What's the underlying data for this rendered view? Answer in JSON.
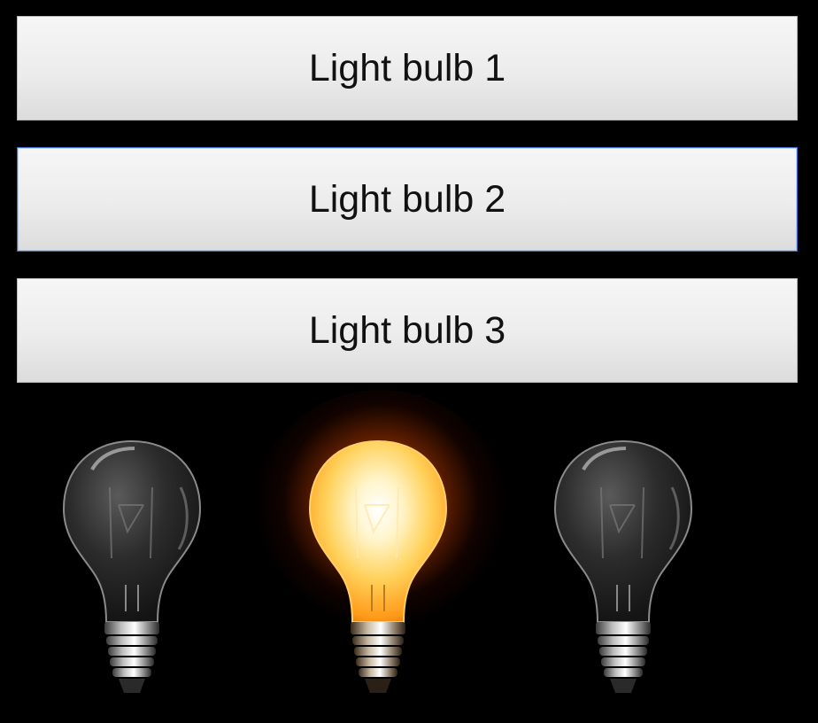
{
  "buttons": [
    {
      "label": "Light bulb 1",
      "state": "off"
    },
    {
      "label": "Light bulb 2",
      "state": "on",
      "focused": true
    },
    {
      "label": "Light bulb 3",
      "state": "off"
    }
  ],
  "colors": {
    "background": "#000000",
    "button_top": "#f6f6f6",
    "button_bottom": "#dcdcdc",
    "button_text": "#111111",
    "focus_border": "#3b6fd8",
    "bulb_on": "#ffd25a",
    "bulb_glow": "#ff8a00",
    "bulb_off_glass": "#2a2a2a"
  },
  "icons": {
    "bulb_off": "light-bulb-off-icon",
    "bulb_on": "light-bulb-on-icon"
  }
}
